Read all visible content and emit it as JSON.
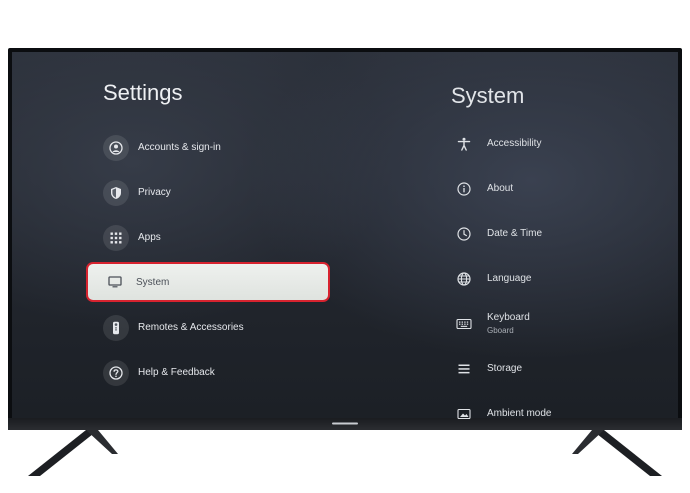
{
  "settings": {
    "title": "Settings",
    "items": [
      {
        "label": "Accounts & sign-in",
        "icon": "account-icon"
      },
      {
        "label": "Privacy",
        "icon": "shield-icon"
      },
      {
        "label": "Apps",
        "icon": "apps-grid-icon"
      },
      {
        "label": "System",
        "icon": "tv-monitor-icon",
        "selected": true
      },
      {
        "label": "Remotes & Accessories",
        "icon": "remote-icon"
      },
      {
        "label": "Help & Feedback",
        "icon": "help-icon"
      }
    ]
  },
  "system": {
    "title": "System",
    "items": [
      {
        "label": "Accessibility",
        "icon": "accessibility-icon"
      },
      {
        "label": "About",
        "icon": "info-icon"
      },
      {
        "label": "Date & Time",
        "icon": "clock-icon"
      },
      {
        "label": "Language",
        "icon": "globe-icon"
      },
      {
        "label": "Keyboard",
        "sublabel": "Gboard",
        "icon": "keyboard-icon"
      },
      {
        "label": "Storage",
        "icon": "storage-icon"
      },
      {
        "label": "Ambient mode",
        "icon": "ambient-icon"
      }
    ]
  },
  "colors": {
    "selection_border": "#d7232f",
    "selection_fill": "#e6e9e6"
  }
}
